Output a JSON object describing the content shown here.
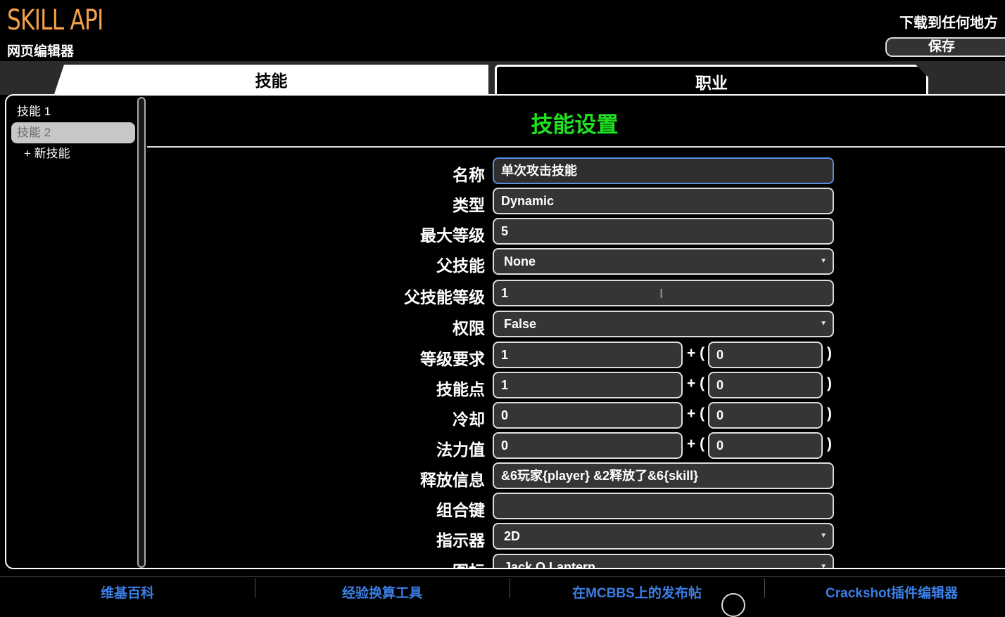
{
  "header": {
    "logo": "SKILL API",
    "subtitle": "网页编辑器",
    "download_label": "下载到任何地方",
    "save_label": "保存"
  },
  "tabs": [
    {
      "label": "技能",
      "active": true
    },
    {
      "label": "职业",
      "active": false
    }
  ],
  "sidebar": {
    "items": [
      {
        "label": "技能 1"
      },
      {
        "label": "技能 2"
      }
    ],
    "new_label": "+ 新技能"
  },
  "main": {
    "title": "技能设置",
    "fields": {
      "name": {
        "label": "名称",
        "value": "单次攻击技能"
      },
      "type": {
        "label": "类型",
        "value": "Dynamic"
      },
      "max_level": {
        "label": "最大等级",
        "value": "5"
      },
      "parent_skill": {
        "label": "父技能",
        "value": "None"
      },
      "parent_level": {
        "label": "父技能等级",
        "value": "1"
      },
      "permission": {
        "label": "权限",
        "value": "False"
      },
      "level_req": {
        "label": "等级要求",
        "base": "1",
        "scale": "0"
      },
      "skill_points": {
        "label": "技能点",
        "base": "1",
        "scale": "0"
      },
      "cooldown": {
        "label": "冷却",
        "base": "0",
        "scale": "0"
      },
      "mana": {
        "label": "法力值",
        "base": "0",
        "scale": "0"
      },
      "cast_message": {
        "label": "释放信息",
        "value": "&6玩家{player} &2释放了&6{skill}"
      },
      "combo": {
        "label": "组合键",
        "value": ""
      },
      "indicator": {
        "label": "指示器",
        "value": "2D"
      },
      "icon": {
        "label": "图标",
        "value": "Jack O Lantern"
      }
    },
    "plus_symbol": "+ (",
    "close_paren": ")",
    "caret_glyph": "▼"
  },
  "footer": {
    "links": [
      {
        "label": "维基百科"
      },
      {
        "label": "经验换算工具"
      },
      {
        "label": "在MCBBS上的发布帖"
      },
      {
        "label": "Crackshot插件编辑器"
      }
    ]
  }
}
